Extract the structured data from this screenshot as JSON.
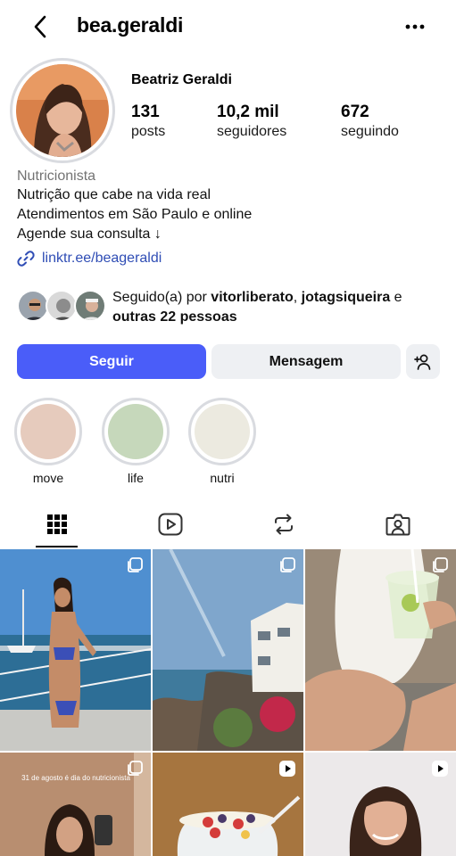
{
  "header": {
    "username": "bea.geraldi",
    "back_icon": "chevron-left-icon",
    "more_icon": "more-horizontal-icon"
  },
  "profile": {
    "full_name": "Beatriz Geraldi",
    "stats": {
      "posts": {
        "value": "131",
        "label": "posts"
      },
      "followers": {
        "value": "10,2 mil",
        "label": "seguidores"
      },
      "following": {
        "value": "672",
        "label": "seguindo"
      }
    },
    "category": "Nutricionista",
    "bio": [
      "Nutrição que cabe na vida real",
      "Atendimentos em São Paulo e online",
      "Agende sua consulta ↓"
    ],
    "link": "linktr.ee/beageraldi"
  },
  "followed_by": {
    "prefix": "Seguido(a) por ",
    "user1": "vitorliberato",
    "separator": ", ",
    "user2": "jotagsiqueira",
    "conjunction": " e",
    "others": "outras 22 pessoas"
  },
  "actions": {
    "follow_label": "Seguir",
    "message_label": "Mensagem",
    "add_person_icon": "person-add-icon"
  },
  "highlights": [
    {
      "label": "move",
      "color": "#e6cbbd"
    },
    {
      "label": "life",
      "color": "#c6d8bb"
    },
    {
      "label": "nutri",
      "color": "#eceae0"
    }
  ],
  "tabs": [
    {
      "name": "grid",
      "icon": "grid-icon",
      "active": true
    },
    {
      "name": "reels",
      "icon": "reels-icon",
      "active": false
    },
    {
      "name": "reposts",
      "icon": "repost-icon",
      "active": false
    },
    {
      "name": "tagged",
      "icon": "tagged-person-icon",
      "active": false
    }
  ],
  "posts": [
    {
      "caption": "",
      "badge": "carousel-icon"
    },
    {
      "caption": "",
      "badge": "carousel-icon"
    },
    {
      "caption": "",
      "badge": "carousel-icon"
    },
    {
      "caption": "31 de agosto é dia do nutricionista",
      "badge": "carousel-icon"
    },
    {
      "caption": "",
      "badge": "reel-icon"
    },
    {
      "caption": "",
      "badge": "reel-icon"
    }
  ],
  "colors": {
    "primary_button": "#4a5df9",
    "secondary_button": "#eef0f3",
    "link": "#2f4db5",
    "muted_text": "#737373"
  }
}
